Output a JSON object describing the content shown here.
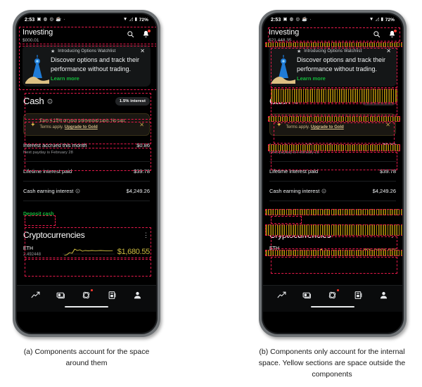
{
  "figure": {
    "caption_a": "(a) Components account for the space around them",
    "caption_b": "(b) Components only account for the internal space. Yellow sections are space outside the components"
  },
  "phone": {
    "statusbar": {
      "time": "2:53",
      "icons": [
        "calendar-icon",
        "whatsapp-icon",
        "record-icon",
        "coffee-icon",
        "dot-icon"
      ],
      "wifi": "wifi-icon",
      "signal": "signal-icon",
      "battery": "battery-icon",
      "battery_pct": "72%"
    },
    "appbar": {
      "title": "Investing",
      "balance_left": "$000.01",
      "balance_right": "$21,448.35",
      "search_icon": "search-icon",
      "notifications_icon": "bell-icon"
    },
    "promo": {
      "eyebrow": "Introducing Options Watchlist",
      "star_icon": "star-icon",
      "body": "Discover options and track their performance without trading.",
      "link": "Learn more",
      "close_icon": "close-icon",
      "art": "lighthouse-illustration"
    },
    "cash": {
      "title": "Cash",
      "info_icon": "info-icon",
      "pill": "1.5% interest"
    },
    "gold_banner": {
      "spark_icon": "sparkle-icon",
      "text_before": "Earn 4.15% on your uninvested cash. No cap. Terms apply. ",
      "link": "Upgrade to Gold",
      "close_icon": "close-icon"
    },
    "rows": [
      {
        "title": "Interest accrued this month",
        "sub": "Next payday is February 28",
        "value": "$0.86",
        "has_info": false
      },
      {
        "title": "Lifetime interest paid",
        "sub": "",
        "value": "$39.78",
        "has_info": false
      },
      {
        "title": "Cash earning interest",
        "sub": "",
        "value": "$4,249.26",
        "has_info": true
      }
    ],
    "deposit_link": "Deposit cash",
    "crypto": {
      "title": "Cryptocurrencies",
      "more_icon": "overflow-menu-icon",
      "holding": {
        "symbol": "ETH",
        "quantity": "2.492448",
        "price": "$1,680.55",
        "sparkline": "sparkline-chart"
      }
    },
    "nav": [
      {
        "name": "nav-investing",
        "icon": "chart-line-icon",
        "badge": false
      },
      {
        "name": "nav-cash",
        "icon": "money-icon",
        "badge": false
      },
      {
        "name": "nav-crypto",
        "icon": "atom-icon",
        "badge": true
      },
      {
        "name": "nav-card",
        "icon": "card-icon",
        "badge": false
      },
      {
        "name": "nav-account",
        "icon": "person-icon",
        "badge": false
      }
    ]
  },
  "colors": {
    "overlay_outline": "#e8194b",
    "overlay_hatch": "#b8930c",
    "accent_green": "#14b83c",
    "accent_gold": "#cdbb3f",
    "screen_bg": "#000000",
    "card_bg": "#141617"
  }
}
